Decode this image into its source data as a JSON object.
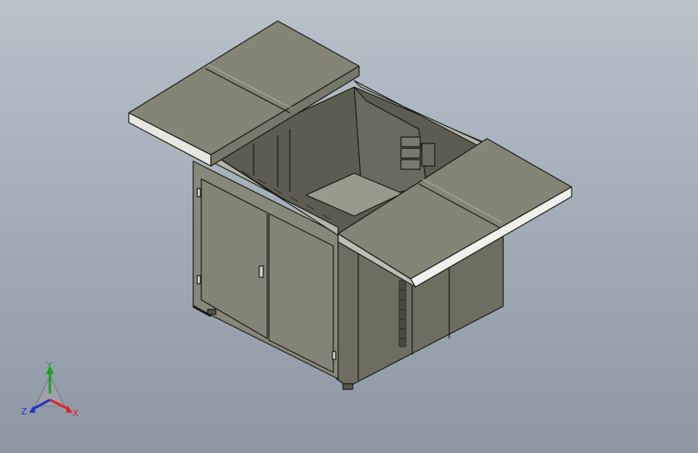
{
  "viewport": {
    "background_top": "#b9c2cb",
    "background_bottom": "#8e98a4"
  },
  "model": {
    "panel_color": "#7d7d6e",
    "panel_light": "#8f8f80",
    "edge_color": "#1a1a14",
    "highlight_color": "#f4f4f0"
  },
  "triad": {
    "x_label": "X",
    "y_label": "Y",
    "z_label": "Z",
    "x_color": "#e02424",
    "y_color": "#1fa11f",
    "z_color": "#2333c8"
  }
}
